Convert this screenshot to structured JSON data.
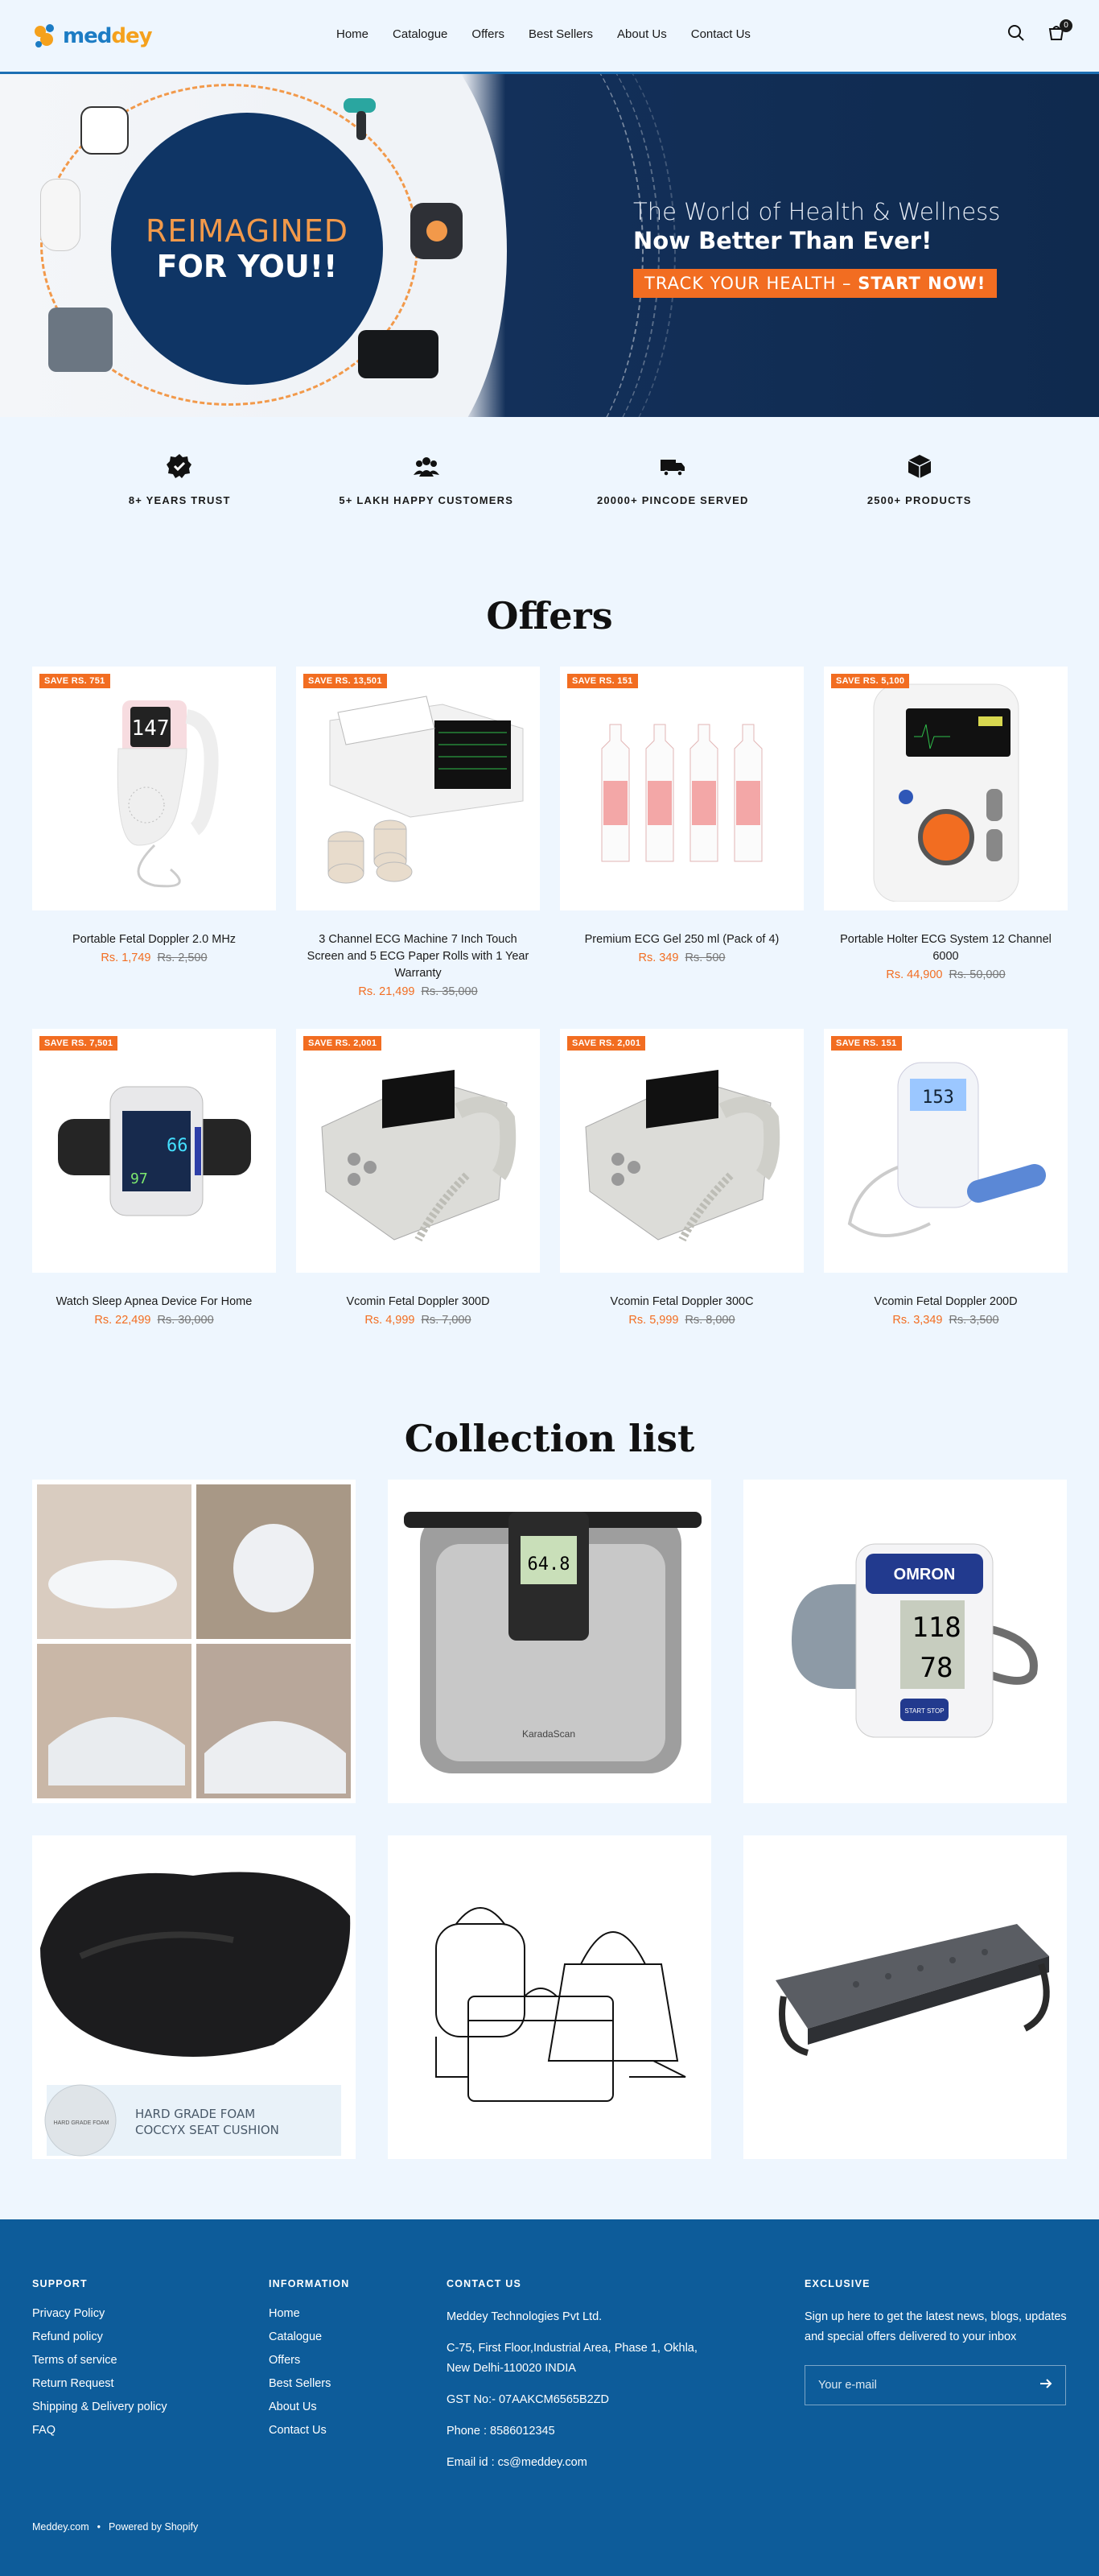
{
  "brand": {
    "name_a": "med",
    "name_b": "dey"
  },
  "nav": [
    "Home",
    "Catalogue",
    "Offers",
    "Best Sellers",
    "About Us",
    "Contact Us"
  ],
  "cart_count": "0",
  "hero": {
    "left_line1": "REIMAGINED",
    "left_line2": "FOR YOU!!",
    "right_line1": "The World of Health & Wellness",
    "right_line2": "Now Better Than Ever!",
    "cta_a": "TRACK YOUR HEALTH – ",
    "cta_b": "START NOW!"
  },
  "trust": [
    {
      "icon": "verified-badge-icon",
      "label": "8+ YEARS TRUST"
    },
    {
      "icon": "happy-customers-icon",
      "label": "5+ LAKH HAPPY CUSTOMERS"
    },
    {
      "icon": "delivery-truck-icon",
      "label": "20000+ PINCODE SERVED"
    },
    {
      "icon": "product-box-icon",
      "label": "2500+ PRODUCTS"
    }
  ],
  "offers_title": "Offers",
  "products": [
    {
      "badge": "SAVE RS. 751",
      "name": "Portable Fetal Doppler 2.0 MHz",
      "price": "Rs. 1,749",
      "was": "Rs. 2,500"
    },
    {
      "badge": "SAVE RS. 13,501",
      "name": "3 Channel ECG Machine 7 Inch Touch Screen and 5 ECG Paper Rolls with 1 Year Warranty",
      "price": "Rs. 21,499",
      "was": "Rs. 35,000"
    },
    {
      "badge": "SAVE RS. 151",
      "name": "Premium ECG Gel 250 ml (Pack of 4)",
      "price": "Rs. 349",
      "was": "Rs. 500"
    },
    {
      "badge": "SAVE RS. 5,100",
      "name": "Portable Holter ECG System 12 Channel 6000",
      "price": "Rs. 44,900",
      "was": "Rs. 50,000"
    },
    {
      "badge": "SAVE RS. 7,501",
      "name": "Watch Sleep Apnea Device For Home",
      "price": "Rs. 22,499",
      "was": "Rs. 30,000"
    },
    {
      "badge": "SAVE RS. 2,001",
      "name": "Vcomin Fetal Doppler 300D",
      "price": "Rs. 4,999",
      "was": "Rs. 7,000"
    },
    {
      "badge": "SAVE RS. 2,001",
      "name": "Vcomin Fetal Doppler 300C",
      "price": "Rs. 5,999",
      "was": "Rs. 8,000"
    },
    {
      "badge": "SAVE RS. 151",
      "name": "Vcomin Fetal Doppler 200D",
      "price": "Rs. 3,349",
      "was": "Rs. 3,500"
    }
  ],
  "collection_title": "Collection list",
  "collections": [
    {
      "icon": "pillow-collage"
    },
    {
      "icon": "body-scale",
      "scale_reading": "64.8",
      "scale_brand": "KaradaScan"
    },
    {
      "icon": "bp-monitor",
      "brand": "OMRON",
      "sys": "118",
      "dia": "78",
      "start": "START STOP"
    },
    {
      "icon": "seat-cushion",
      "caption": "HARD GRADE FOAM COCCYX SEAT CUSHION",
      "seal": "HARD GRADE FOAM"
    },
    {
      "icon": "bags-outline"
    },
    {
      "icon": "foot-rest"
    }
  ],
  "footer": {
    "support_head": "SUPPORT",
    "support": [
      "Privacy Policy",
      "Refund policy",
      "Terms of service",
      "Return Request",
      "Shipping & Delivery policy",
      "FAQ"
    ],
    "info_head": "INFORMATION",
    "info": [
      "Home",
      "Catalogue",
      "Offers",
      "Best Sellers",
      "About Us",
      "Contact Us"
    ],
    "contact_head": "CONTACT US",
    "company": "Meddey Technologies Pvt Ltd.",
    "address": "C-75, First Floor,Industrial Area, Phase 1, Okhla, New Delhi-110020 INDIA",
    "gst": "GST No:- 07AAKCM6565B2ZD",
    "phone": "Phone : 8586012345",
    "email": "Email id : cs@meddey.com",
    "excl_head": "EXCLUSIVE",
    "excl_text": "Sign up here to get the latest news, blogs, updates and special offers delivered to your inbox",
    "email_placeholder": "Your e-mail",
    "bottom_left": "Meddey.com",
    "bottom_right": "Powered by Shopify"
  },
  "colors": {
    "accent": "#f26d21",
    "footer": "#0d5c9a",
    "hero_navy": "#0f3565"
  }
}
